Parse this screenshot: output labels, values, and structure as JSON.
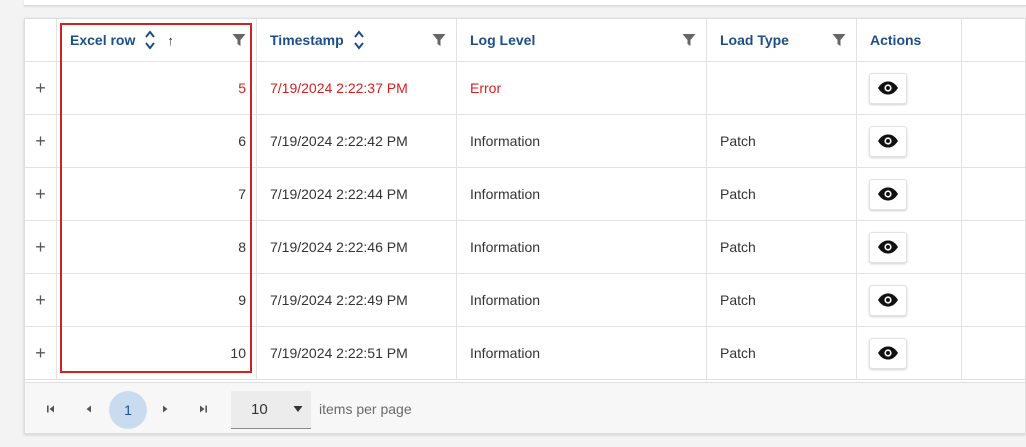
{
  "grid": {
    "columns": [
      {
        "label": "Excel row",
        "sortable": true,
        "sorted_ascending": true,
        "filterable": true
      },
      {
        "label": "Timestamp",
        "sortable": true,
        "sorted_ascending": false,
        "filterable": true
      },
      {
        "label": "Log Level",
        "sortable": false,
        "filterable": true
      },
      {
        "label": "Load Type",
        "sortable": false,
        "filterable": true
      },
      {
        "label": "Actions",
        "sortable": false,
        "filterable": false
      }
    ],
    "asc_indicator": "↑",
    "expand_glyph": "+",
    "rows": [
      {
        "excel_row": "5",
        "timestamp": "7/19/2024 2:22:37 PM",
        "log_level": "Error",
        "load_type": "",
        "is_error": true
      },
      {
        "excel_row": "6",
        "timestamp": "7/19/2024 2:22:42 PM",
        "log_level": "Information",
        "load_type": "Patch",
        "is_error": false
      },
      {
        "excel_row": "7",
        "timestamp": "7/19/2024 2:22:44 PM",
        "log_level": "Information",
        "load_type": "Patch",
        "is_error": false
      },
      {
        "excel_row": "8",
        "timestamp": "7/19/2024 2:22:46 PM",
        "log_level": "Information",
        "load_type": "Patch",
        "is_error": false
      },
      {
        "excel_row": "9",
        "timestamp": "7/19/2024 2:22:49 PM",
        "log_level": "Information",
        "load_type": "Patch",
        "is_error": false
      },
      {
        "excel_row": "10",
        "timestamp": "7/19/2024 2:22:51 PM",
        "log_level": "Information",
        "load_type": "Patch",
        "is_error": false
      }
    ],
    "action_icon": "eye-icon"
  },
  "pager": {
    "current_page": "1",
    "page_size": "10",
    "items_per_page_label": "items per page",
    "icons": [
      "first-page-icon",
      "prev-page-icon",
      "next-page-icon",
      "last-page-icon",
      "caret-down-icon"
    ]
  },
  "colors": {
    "header_text": "#1d4e89",
    "error_text": "#d61f1f",
    "highlight_border": "#cc2424",
    "current_page_bg": "#c9dbef"
  }
}
